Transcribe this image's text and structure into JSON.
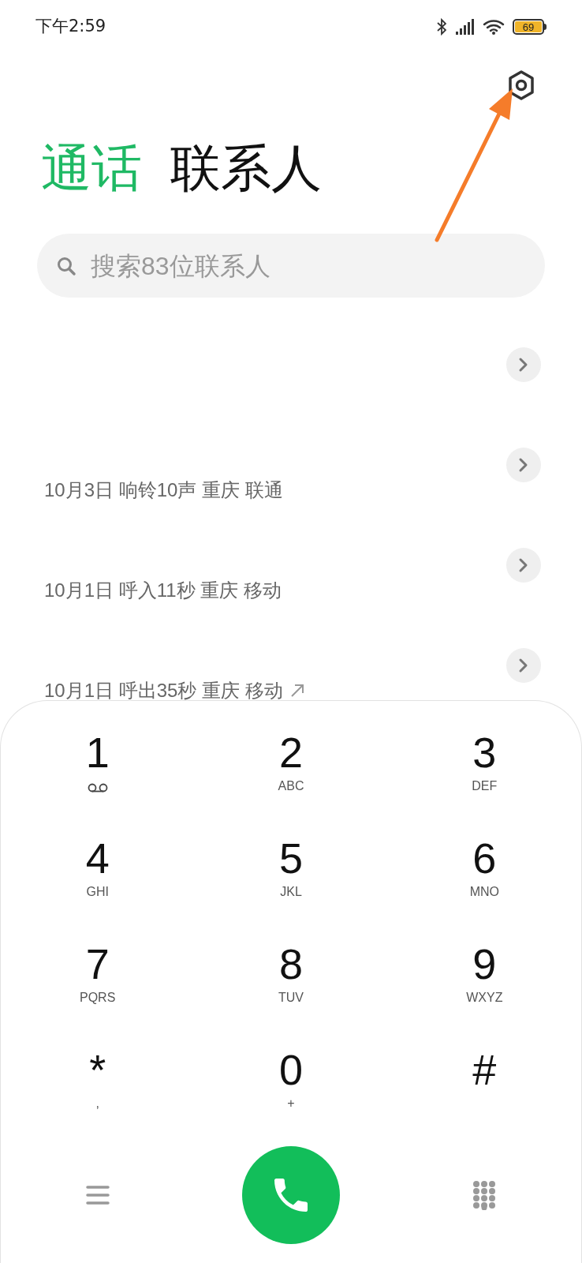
{
  "status_bar": {
    "time": "下午2:59",
    "battery": "69"
  },
  "tabs": [
    {
      "label": "通话",
      "selected": true
    },
    {
      "label": "联系人",
      "selected": false
    }
  ],
  "search": {
    "placeholder": "搜索83位联系人"
  },
  "calls": [
    {
      "outgoing": false
    },
    {
      "detail": "10月3日 响铃10声 重庆 联通",
      "outgoing": false
    },
    {
      "detail": "10月1日 呼入11秒 重庆 移动",
      "outgoing": false
    },
    {
      "detail": "10月1日 呼出35秒 重庆 移动",
      "outgoing": true
    }
  ],
  "keypad": [
    {
      "digit": "1",
      "kind": "voicemail"
    },
    {
      "digit": "2",
      "kind": "letters",
      "sub": "ABC"
    },
    {
      "digit": "3",
      "kind": "letters",
      "sub": "DEF"
    },
    {
      "digit": "4",
      "kind": "letters",
      "sub": "GHI"
    },
    {
      "digit": "5",
      "kind": "letters",
      "sub": "JKL"
    },
    {
      "digit": "6",
      "kind": "letters",
      "sub": "MNO"
    },
    {
      "digit": "7",
      "kind": "letters",
      "sub": "PQRS"
    },
    {
      "digit": "8",
      "kind": "letters",
      "sub": "TUV"
    },
    {
      "digit": "9",
      "kind": "letters",
      "sub": "WXYZ"
    },
    {
      "digit": "*",
      "kind": "letters",
      "sub": ","
    },
    {
      "digit": "0",
      "kind": "letters",
      "sub": "+"
    },
    {
      "digit": "#",
      "kind": "none"
    }
  ]
}
